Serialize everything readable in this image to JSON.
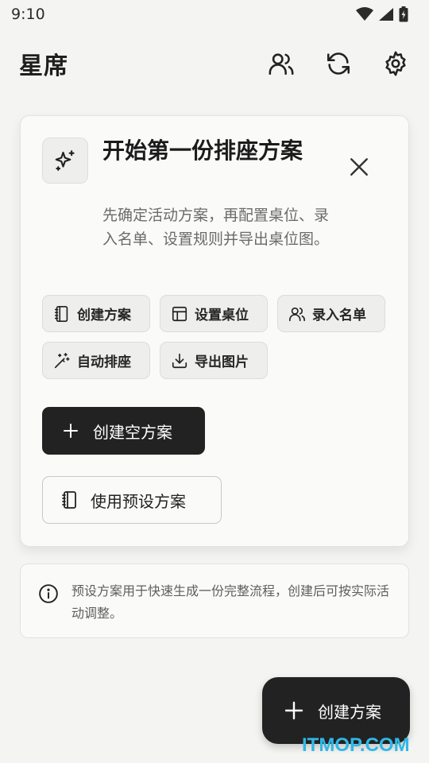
{
  "status": {
    "time": "9:10",
    "icons": [
      "wifi-icon",
      "signal-icon",
      "battery-icon"
    ]
  },
  "appbar": {
    "title": "星席",
    "actions": [
      "people-icon",
      "refresh-icon",
      "settings-icon"
    ]
  },
  "card": {
    "icon": "sparkles-icon",
    "title": "开始第一份排座方案",
    "description": "先确定活动方案，再配置桌位、录入名单、设置规则并导出桌位图。",
    "chips": [
      {
        "icon": "notebook-icon",
        "label": "创建方案"
      },
      {
        "icon": "table-icon",
        "label": "设置桌位"
      },
      {
        "icon": "people-icon",
        "label": "录入名单"
      },
      {
        "icon": "magic-wand-icon",
        "label": "自动排座"
      },
      {
        "icon": "download-icon",
        "label": "导出图片"
      }
    ],
    "primary_label": "创建空方案",
    "secondary_label": "使用预设方案"
  },
  "info": {
    "text": "预设方案用于快速生成一份完整流程，创建后可按实际活动调整。"
  },
  "fab": {
    "label": "创建方案"
  },
  "watermark": "ITMOP.COM",
  "colors": {
    "primary": "#222222",
    "background": "#f4f4f3",
    "card": "#fafaf9",
    "watermark": "#2fb8e6"
  }
}
